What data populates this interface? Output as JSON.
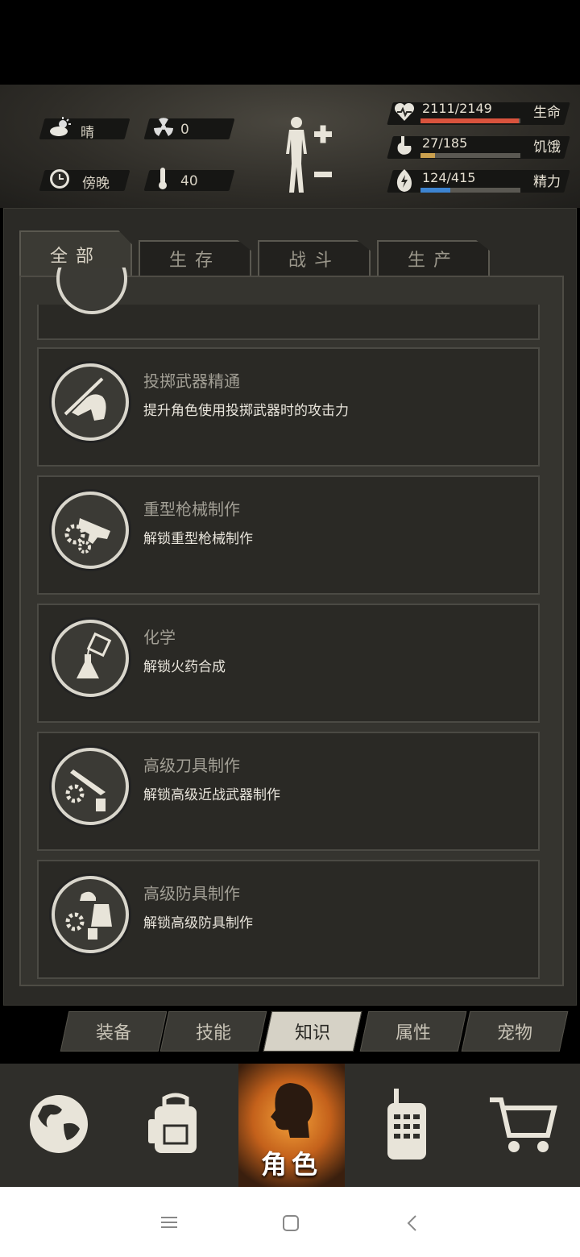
{
  "hud": {
    "weather_icon": "cloud-sun-icon",
    "weather": "晴",
    "radiation_icon": "radiation-icon",
    "radiation": "0",
    "time_icon": "clock-icon",
    "time_of_day": "傍晚",
    "temperature_icon": "thermometer-icon",
    "temperature": "40",
    "stats": [
      {
        "icon": "heart-icon",
        "value": "2111/2149",
        "label": "生命",
        "fraction": 0.982,
        "color": "#d9533d"
      },
      {
        "icon": "stomach-icon",
        "value": "27/185",
        "label": "饥饿",
        "fraction": 0.146,
        "color": "#caa04e"
      },
      {
        "icon": "energy-icon",
        "value": "124/415",
        "label": "精力",
        "fraction": 0.299,
        "color": "#3d84d1"
      }
    ]
  },
  "category_tabs": [
    {
      "label": "全部",
      "active": true
    },
    {
      "label": "生存",
      "active": false
    },
    {
      "label": "战斗",
      "active": false
    },
    {
      "label": "生产",
      "active": false
    }
  ],
  "knowledge": [
    {
      "icon": "throwing-spear-icon",
      "title": "投掷武器精通",
      "desc": "提升角色使用投掷武器时的攻击力"
    },
    {
      "icon": "heavy-gun-crafting-icon",
      "title": "重型枪械制作",
      "desc": "解锁重型枪械制作"
    },
    {
      "icon": "chemistry-flask-icon",
      "title": "化学",
      "desc": "解锁火药合成"
    },
    {
      "icon": "knife-crafting-icon",
      "title": "高级刀具制作",
      "desc": "解锁高级近战武器制作"
    },
    {
      "icon": "armor-crafting-icon",
      "title": "高级防具制作",
      "desc": "解锁高级防具制作"
    }
  ],
  "sub_tabs": [
    {
      "label": "装备",
      "active": false
    },
    {
      "label": "技能",
      "active": false
    },
    {
      "label": "知识",
      "active": true
    },
    {
      "label": "属性",
      "active": false
    },
    {
      "label": "宠物",
      "active": false
    }
  ],
  "bottom_nav": {
    "map_icon": "globe-icon",
    "inventory_icon": "backpack-icon",
    "role_label": "角色",
    "role_icon": "head-icon",
    "radio_icon": "walkie-talkie-icon",
    "shop_icon": "cart-icon"
  },
  "system_nav": {
    "menu_icon": "menu-icon",
    "home_icon": "home-icon",
    "back_icon": "back-icon"
  }
}
